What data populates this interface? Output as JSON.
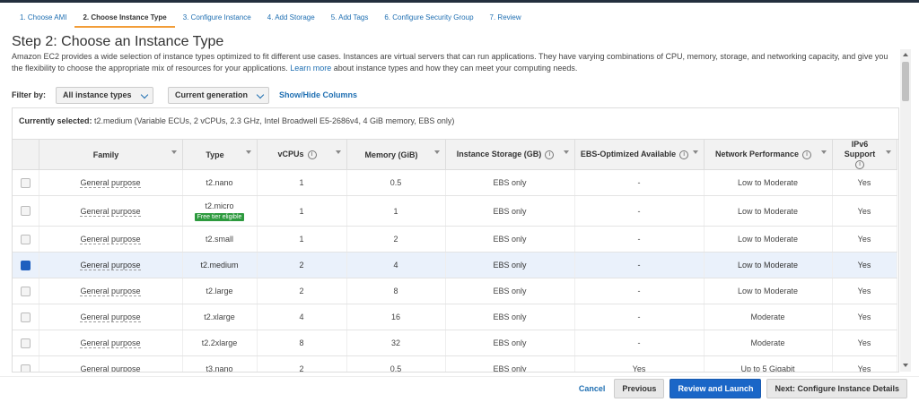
{
  "wizard": {
    "tabs": [
      {
        "label": "1. Choose AMI"
      },
      {
        "label": "2. Choose Instance Type"
      },
      {
        "label": "3. Configure Instance"
      },
      {
        "label": "4. Add Storage"
      },
      {
        "label": "5. Add Tags"
      },
      {
        "label": "6. Configure Security Group"
      },
      {
        "label": "7. Review"
      }
    ],
    "active_index": 1
  },
  "page": {
    "title": "Step 2: Choose an Instance Type",
    "description": "Amazon EC2 provides a wide selection of instance types optimized to fit different use cases. Instances are virtual servers that can run applications. They have varying combinations of CPU, memory, storage, and networking capacity, and give you the flexibility to choose the appropriate mix of resources for your applications.",
    "learn_more": "Learn more",
    "description_tail": "about instance types and how they can meet your computing needs."
  },
  "filter": {
    "label": "Filter by:",
    "type_select": "All instance types",
    "generation_select": "Current generation",
    "show_hide": "Show/Hide Columns"
  },
  "current": {
    "label": "Currently selected:",
    "value": "t2.medium (Variable ECUs, 2 vCPUs, 2.3 GHz, Intel Broadwell E5-2686v4, 4 GiB memory, EBS only)"
  },
  "table": {
    "columns": [
      "Family",
      "Type",
      "vCPUs",
      "Memory (GiB)",
      "Instance Storage (GB)",
      "EBS-Optimized Available",
      "Network Performance",
      "IPv6 Support"
    ],
    "info_icon": "i",
    "rows": [
      {
        "checked": false,
        "family": "General purpose",
        "type": "t2.nano",
        "badge": "",
        "vcpus": "1",
        "memory": "0.5",
        "storage": "EBS only",
        "ebs_opt": "-",
        "network": "Low to Moderate",
        "ipv6": "Yes"
      },
      {
        "checked": false,
        "family": "General purpose",
        "type": "t2.micro",
        "badge": "Free tier eligible",
        "vcpus": "1",
        "memory": "1",
        "storage": "EBS only",
        "ebs_opt": "-",
        "network": "Low to Moderate",
        "ipv6": "Yes"
      },
      {
        "checked": false,
        "family": "General purpose",
        "type": "t2.small",
        "badge": "",
        "vcpus": "1",
        "memory": "2",
        "storage": "EBS only",
        "ebs_opt": "-",
        "network": "Low to Moderate",
        "ipv6": "Yes"
      },
      {
        "checked": true,
        "family": "General purpose",
        "type": "t2.medium",
        "badge": "",
        "vcpus": "2",
        "memory": "4",
        "storage": "EBS only",
        "ebs_opt": "-",
        "network": "Low to Moderate",
        "ipv6": "Yes"
      },
      {
        "checked": false,
        "family": "General purpose",
        "type": "t2.large",
        "badge": "",
        "vcpus": "2",
        "memory": "8",
        "storage": "EBS only",
        "ebs_opt": "-",
        "network": "Low to Moderate",
        "ipv6": "Yes"
      },
      {
        "checked": false,
        "family": "General purpose",
        "type": "t2.xlarge",
        "badge": "",
        "vcpus": "4",
        "memory": "16",
        "storage": "EBS only",
        "ebs_opt": "-",
        "network": "Moderate",
        "ipv6": "Yes"
      },
      {
        "checked": false,
        "family": "General purpose",
        "type": "t2.2xlarge",
        "badge": "",
        "vcpus": "8",
        "memory": "32",
        "storage": "EBS only",
        "ebs_opt": "-",
        "network": "Moderate",
        "ipv6": "Yes"
      },
      {
        "checked": false,
        "family": "General purpose",
        "type": "t3.nano",
        "badge": "",
        "vcpus": "2",
        "memory": "0.5",
        "storage": "EBS only",
        "ebs_opt": "Yes",
        "network": "Up to 5 Gigabit",
        "ipv6": "Yes"
      }
    ]
  },
  "footer": {
    "cancel": "Cancel",
    "previous": "Previous",
    "review_launch": "Review and Launch",
    "next": "Next: Configure Instance Details"
  },
  "colors": {
    "link": "#1f6fb2",
    "primary_button": "#1a66c7",
    "active_tab_underline": "#f29d38",
    "free_tier_badge": "#2d9a3e",
    "selected_row": "#eaf1fb"
  }
}
